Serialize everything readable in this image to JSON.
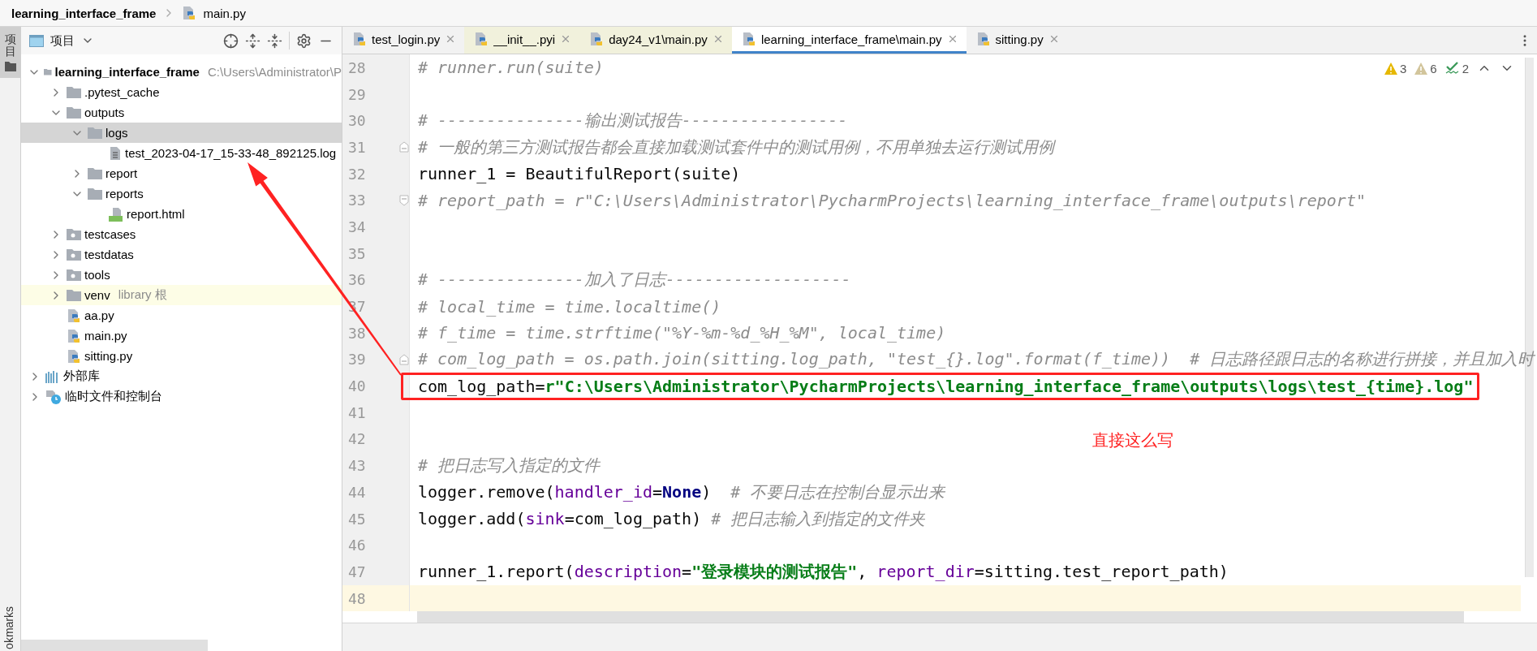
{
  "breadcrumb": {
    "project": "learning_interface_frame",
    "file": "main.py"
  },
  "side_tabs": [
    {
      "label": "项目",
      "selected": true
    }
  ],
  "bottom_side_tab": "okmarks",
  "project_panel": {
    "title": "项目",
    "tree": [
      {
        "label": "learning_interface_frame",
        "hint": "C:\\Users\\Administrator\\P",
        "kind": "root",
        "expanded": true,
        "selected": false,
        "highlighted": false,
        "children": [
          {
            "label": ".pytest_cache",
            "kind": "folder",
            "expanded": false,
            "selected": false,
            "highlighted": false
          },
          {
            "label": "outputs",
            "kind": "folder",
            "expanded": true,
            "selected": false,
            "highlighted": false,
            "children": [
              {
                "label": "logs",
                "kind": "folder",
                "expanded": true,
                "selected": true,
                "highlighted": false,
                "children": [
                  {
                    "label": "test_2023-04-17_15-33-48_892125.log",
                    "kind": "log",
                    "selected": false,
                    "highlighted": false
                  }
                ]
              },
              {
                "label": "report",
                "kind": "folder",
                "expanded": false,
                "selected": false,
                "highlighted": false
              },
              {
                "label": "reports",
                "kind": "folder",
                "expanded": true,
                "selected": false,
                "highlighted": false,
                "children": [
                  {
                    "label": "report.html",
                    "kind": "html",
                    "selected": false,
                    "highlighted": false
                  }
                ]
              }
            ]
          },
          {
            "label": "testcases",
            "kind": "package",
            "expanded": false,
            "selected": false,
            "highlighted": false
          },
          {
            "label": "testdatas",
            "kind": "package",
            "expanded": false,
            "selected": false,
            "highlighted": false
          },
          {
            "label": "tools",
            "kind": "package",
            "expanded": false,
            "selected": false,
            "highlighted": false
          },
          {
            "label": "venv",
            "hint": "library 根",
            "kind": "folder",
            "expanded": false,
            "selected": false,
            "highlighted": true
          },
          {
            "label": "aa.py",
            "kind": "python",
            "selected": false,
            "highlighted": false
          },
          {
            "label": "main.py",
            "kind": "python",
            "selected": false,
            "highlighted": false
          },
          {
            "label": "sitting.py",
            "kind": "python",
            "selected": false,
            "highlighted": false
          }
        ]
      },
      {
        "label": "外部库",
        "kind": "library",
        "expanded": false,
        "selected": false,
        "highlighted": false
      },
      {
        "label": "临时文件和控制台",
        "kind": "scratch",
        "expanded": false,
        "selected": false,
        "highlighted": false
      }
    ]
  },
  "tabs": [
    {
      "label": "test_login.py",
      "selected": false,
      "color": "#f2f2f2"
    },
    {
      "label": "__init__.pyi",
      "selected": false,
      "color": "#f1f1dc"
    },
    {
      "label": "day24_v1\\main.py",
      "selected": false,
      "color": "#f1f1dc"
    },
    {
      "label": "learning_interface_frame\\main.py",
      "selected": true,
      "color": "#ffffff"
    },
    {
      "label": "sitting.py",
      "selected": false,
      "color": "#f2f2f2"
    }
  ],
  "editor": {
    "inspections": [
      {
        "kind": "warning",
        "count": "3"
      },
      {
        "kind": "weak_warning",
        "count": "6"
      },
      {
        "kind": "typo",
        "count": "2"
      }
    ],
    "lines": [
      {
        "n": "28",
        "current": false,
        "segs": [
          {
            "kind": "comment",
            "text": "# runner.run(suite)"
          }
        ]
      },
      {
        "n": "29",
        "current": false
      },
      {
        "n": "30",
        "current": false,
        "segs": [
          {
            "kind": "comment",
            "text": "# ---------------输出测试报告-----------------"
          }
        ]
      },
      {
        "n": "31",
        "current": false,
        "fold": {
          "kind": "start"
        },
        "segs": [
          {
            "kind": "comment",
            "text": "# 一般的第三方测试报告都会直接加载测试套件中的测试用例，不用单独去运行测试用例"
          }
        ]
      },
      {
        "n": "32",
        "current": false,
        "segs": [
          {
            "kind": "plain",
            "text": "runner_1 = BeautifulReport(suite)"
          }
        ]
      },
      {
        "n": "33",
        "current": false,
        "fold": {
          "kind": "end"
        },
        "segs": [
          {
            "kind": "comment",
            "text": "# report_path = r\"C:\\Users\\Administrator\\PycharmProjects\\learning_interface_frame\\outputs\\report\""
          }
        ]
      },
      {
        "n": "34",
        "current": false
      },
      {
        "n": "35",
        "current": false
      },
      {
        "n": "36",
        "current": false,
        "segs": [
          {
            "kind": "comment",
            "text": "# ---------------加入了日志-------------------"
          }
        ]
      },
      {
        "n": "37",
        "current": false,
        "segs": [
          {
            "kind": "comment",
            "text": "# local_time = time.localtime()"
          }
        ]
      },
      {
        "n": "38",
        "current": false,
        "segs": [
          {
            "kind": "comment",
            "text": "# f_time = time.strftime(\"%Y-%m-%d_%H_%M\", local_time)"
          }
        ]
      },
      {
        "n": "39",
        "current": false,
        "fold": {
          "kind": "start"
        },
        "segs": [
          {
            "kind": "comment",
            "text": "# com_log_path = os.path.join(sitting.log_path, \"test_{}.log\".format(f_time))  # 日志路径跟日志的名称进行拼接，并且加入时"
          }
        ]
      },
      {
        "n": "40",
        "current": false,
        "boxed": true,
        "segs": [
          {
            "kind": "plain",
            "text": "com_log_path="
          },
          {
            "kind": "string",
            "text": "r\"C:\\Users\\Administrator\\PycharmProjects\\learning_interface_frame\\outputs\\logs\\test_{time}.log\""
          }
        ]
      },
      {
        "n": "41",
        "current": false
      },
      {
        "n": "42",
        "current": false
      },
      {
        "n": "43",
        "current": false,
        "segs": [
          {
            "kind": "comment",
            "text": "# 把日志写入指定的文件"
          }
        ]
      },
      {
        "n": "44",
        "current": false,
        "segs": [
          {
            "kind": "plain",
            "text": "logger.remove("
          },
          {
            "kind": "param",
            "text": "handler_id"
          },
          {
            "kind": "plain",
            "text": "="
          },
          {
            "kind": "keyword",
            "text": "None"
          },
          {
            "kind": "plain",
            "text": ")  "
          },
          {
            "kind": "comment",
            "text": "# 不要日志在控制台显示出来"
          }
        ]
      },
      {
        "n": "45",
        "current": false,
        "segs": [
          {
            "kind": "plain",
            "text": "logger.add("
          },
          {
            "kind": "param",
            "text": "sink"
          },
          {
            "kind": "plain",
            "text": "=com_log_path) "
          },
          {
            "kind": "comment",
            "text": "# 把日志输入到指定的文件夹"
          }
        ]
      },
      {
        "n": "46",
        "current": false
      },
      {
        "n": "47",
        "current": false,
        "segs": [
          {
            "kind": "plain",
            "text": "runner_1.report("
          },
          {
            "kind": "param",
            "text": "description"
          },
          {
            "kind": "plain",
            "text": "="
          },
          {
            "kind": "string",
            "text": "\"登录模块的测试报告\""
          },
          {
            "kind": "plain",
            "text": ", "
          },
          {
            "kind": "param",
            "text": "report_dir"
          },
          {
            "kind": "plain",
            "text": "=sitting.test_report_path)"
          }
        ]
      },
      {
        "n": "48",
        "current": true
      }
    ]
  },
  "note": "直接这么写"
}
